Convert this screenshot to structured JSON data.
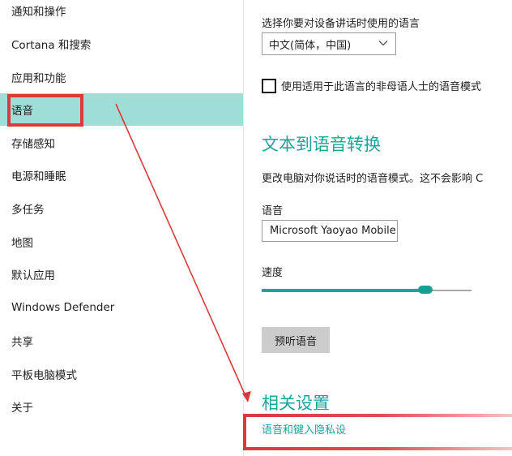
{
  "sidebar": {
    "items": [
      {
        "label": "通知和操作"
      },
      {
        "label": "Cortana 和搜索"
      },
      {
        "label": "应用和功能"
      },
      {
        "label": "语音"
      },
      {
        "label": "存储感知"
      },
      {
        "label": "电源和睡眠"
      },
      {
        "label": "多任务"
      },
      {
        "label": "地图"
      },
      {
        "label": "默认应用"
      },
      {
        "label": "Windows Defender"
      },
      {
        "label": "共享"
      },
      {
        "label": "平板电脑模式"
      },
      {
        "label": "关于"
      }
    ],
    "selected_index": 3
  },
  "speech_language": {
    "label": "选择你要对设备讲话时使用的语言",
    "selected_value": "中文(简体，中国)",
    "checkbox_label": "使用适用于此语言的非母语人士的语音模式",
    "checkbox_checked": false
  },
  "tts": {
    "title": "文本到语音转换",
    "description": "更改电脑对你说话时的语音模式。这不会影响 C",
    "voice_label": "语音",
    "voice_value": "Microsoft Yaoyao Mobile",
    "speed_label": "速度",
    "speed_fraction": 0.78,
    "preview_button": "预听语音"
  },
  "related": {
    "title": "相关设置",
    "link": "语音和键入隐私设"
  },
  "colors": {
    "accent": "#1aa59a",
    "selected_bg": "#9fded6",
    "annotation_red": "#d83b3b"
  },
  "icons": {
    "dropdown": "chevron-down-icon",
    "annotation": "arrow-icon"
  }
}
